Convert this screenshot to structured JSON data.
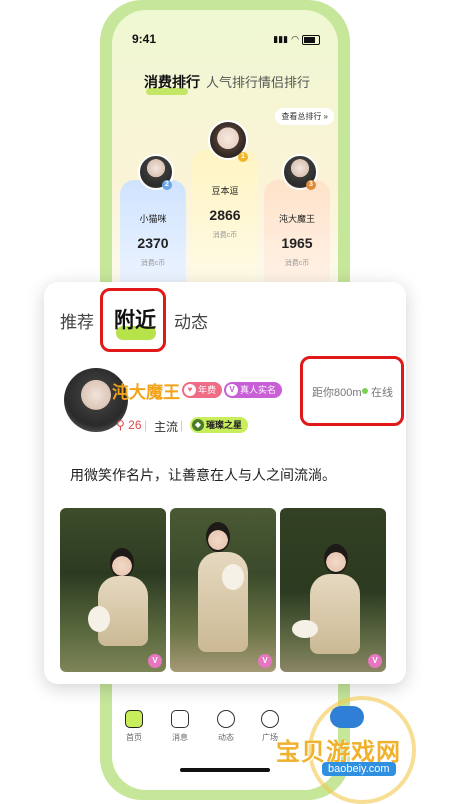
{
  "status": {
    "time": "9:41"
  },
  "ranking": {
    "tabs": [
      "消费排行",
      "人气排行",
      "情侣排行"
    ],
    "view_all": "查看总排行",
    "top3": [
      {
        "rank": "2",
        "name": "小猫咪",
        "value": "2370",
        "unit": "消费c币"
      },
      {
        "rank": "1",
        "name": "豆本逗",
        "value": "2866",
        "unit": "消费c币"
      },
      {
        "rank": "3",
        "name": "沌大魔王",
        "value": "1965",
        "unit": "消费c币"
      }
    ]
  },
  "card": {
    "tabs": [
      "推荐",
      "附近",
      "动态"
    ],
    "user": {
      "name": "沌大魔王",
      "badge_vip": "年费",
      "badge_verified": "真人实名",
      "likes": "26",
      "tag": "主流",
      "honor": "璀璨之星",
      "distance": "距你800m",
      "status": "在线"
    },
    "bio": "用微笑作名片，让善意在人与人之间流淌。",
    "photo_tag": "V"
  },
  "nav": {
    "items": [
      {
        "label": "首页",
        "icon": "home-icon"
      },
      {
        "label": "消息",
        "icon": "message-icon"
      },
      {
        "label": "动态",
        "icon": "moments-icon"
      },
      {
        "label": "广场",
        "icon": "plaza-icon"
      }
    ]
  },
  "watermark": {
    "text": "宝贝游戏网",
    "url": "baobeiy.com"
  },
  "colors": {
    "accent": "#b6e24a",
    "highlight": "#e01818",
    "name": "#f2a31a"
  }
}
